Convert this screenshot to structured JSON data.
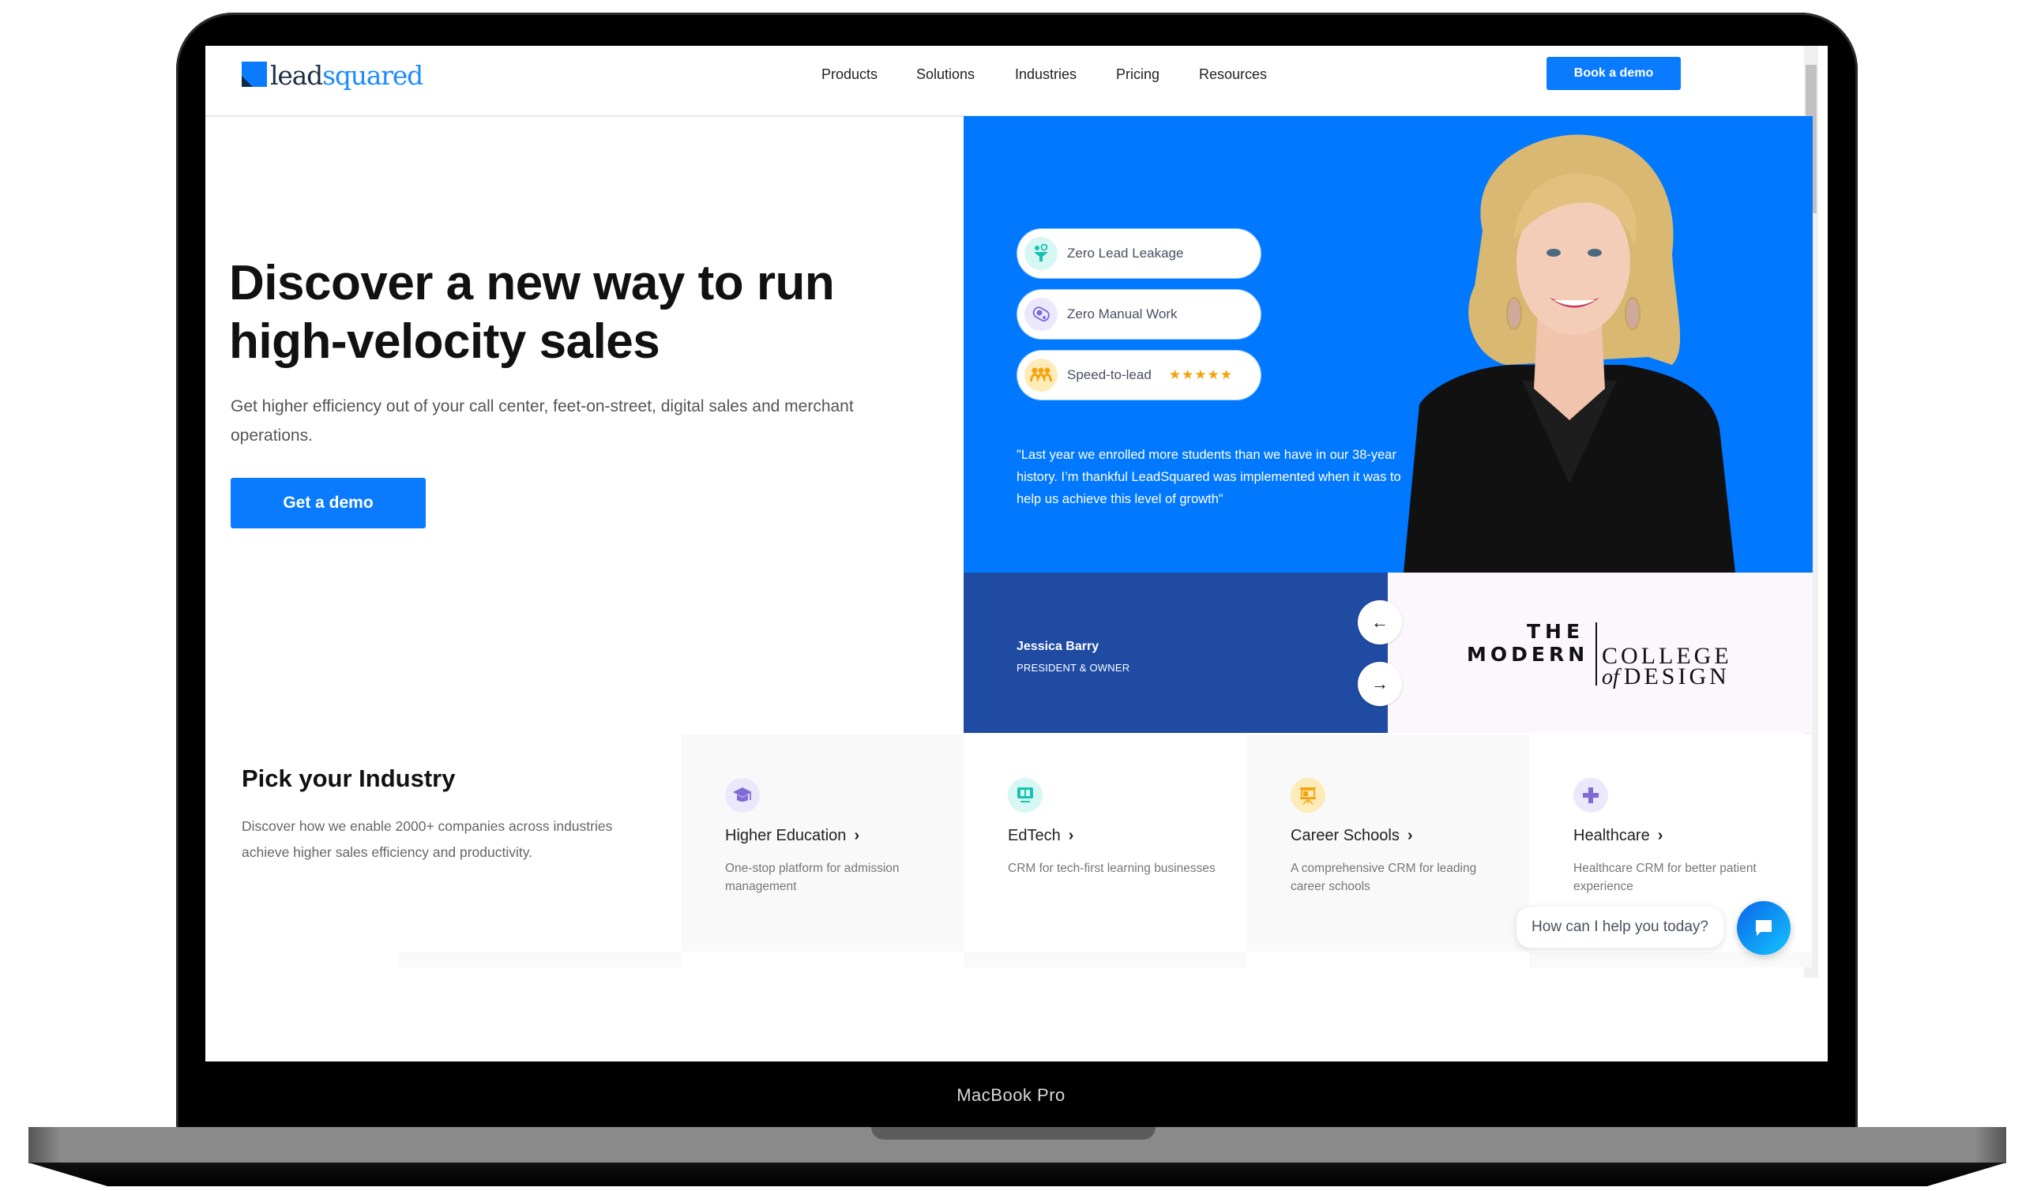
{
  "device": {
    "label": "MacBook Pro"
  },
  "header": {
    "logo": {
      "part1": "lead",
      "part2": "squared"
    },
    "nav": [
      {
        "label": "Products"
      },
      {
        "label": "Solutions"
      },
      {
        "label": "Industries"
      },
      {
        "label": "Pricing"
      },
      {
        "label": "Resources"
      }
    ],
    "cta_label": "Book a demo"
  },
  "hero": {
    "headline_line1": "Discover a new way to run",
    "headline_line2": "high-velocity sales",
    "subtext": "Get higher efficiency out of your call center, feet-on-street, digital sales and merchant operations.",
    "cta_label": "Get a demo"
  },
  "testimonial": {
    "features": [
      {
        "label": "Zero Lead Leakage",
        "icon": "funnel-icon",
        "icon_bg": "#d6f7f4",
        "icon_color": "#19c2b0"
      },
      {
        "label": "Zero Manual Work",
        "icon": "automation-gear-icon",
        "icon_bg": "#ebe8fb",
        "icon_color": "#7e6bd6"
      },
      {
        "label": "Speed-to-lead",
        "icon": "team-icon",
        "icon_bg": "#fdebb9",
        "icon_color": "#f5a30a",
        "rating": "★★★★★"
      }
    ],
    "quote": "\"Last year we enrolled more students than we have in our 38-year history. I’m thankful LeadSquared was implemented when it was to help us achieve this level of growth\"",
    "person_name": "Jessica Barry",
    "person_title": "PRESIDENT & OWNER",
    "company_logo": {
      "line1": "THE",
      "line2": "MODERN",
      "line3": "COLLEGE",
      "line4_prefix": "of",
      "line4": "DESIGN"
    },
    "prev_icon": "←",
    "next_icon": "→"
  },
  "industries": {
    "title": "Pick your Industry",
    "description": "Discover how we enable 2000+ companies across industries achieve higher sales efficiency and productivity.",
    "cards": [
      {
        "title": "Higher Education",
        "desc": "One-stop platform for admission management",
        "icon": "graduation-cap-icon",
        "icon_bg": "#ebe8fb",
        "icon_color": "#7e6bd6"
      },
      {
        "title": "EdTech",
        "desc": "CRM for tech-first learning businesses",
        "icon": "monitor-book-icon",
        "icon_bg": "#d6f7f4",
        "icon_color": "#19c2b0"
      },
      {
        "title": "Career Schools",
        "desc": "A comprehensive CRM for leading career schools",
        "icon": "presentation-board-icon",
        "icon_bg": "#fdebb9",
        "icon_color": "#f5a30a"
      },
      {
        "title": "Healthcare",
        "desc": "Healthcare CRM for better patient experience",
        "icon": "medical-cross-icon",
        "icon_bg": "#ebe8fb",
        "icon_color": "#7e6bd6"
      }
    ],
    "chevron": "›"
  },
  "chat": {
    "prompt": "How can I help you today?"
  },
  "colors": {
    "brand_blue": "#0a7bff",
    "panel_blue": "#0078ff",
    "dark_blue": "#1f4ba3"
  }
}
